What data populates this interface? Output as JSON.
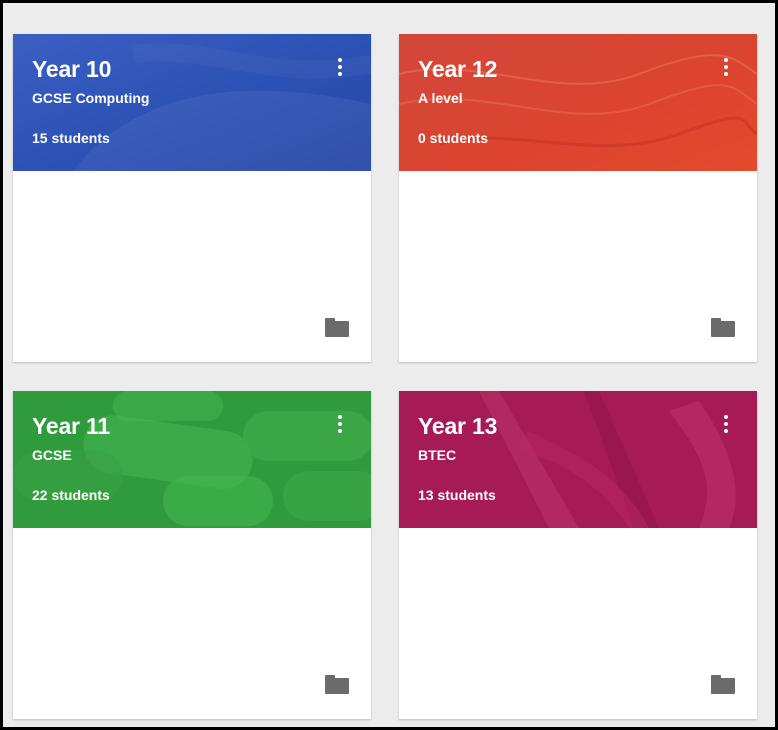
{
  "classes": [
    {
      "title": "Year 10",
      "subtitle": "GCSE Computing",
      "students": "15 students",
      "theme": "#2f56b8"
    },
    {
      "title": "Year 12",
      "subtitle": "A level",
      "students": "0 students",
      "theme": "#d9412e"
    },
    {
      "title": "Year 11",
      "subtitle": "GCSE",
      "students": "22 students",
      "theme": "#2f9b3d"
    },
    {
      "title": "Year 13",
      "subtitle": "BTEC",
      "students": "13 students",
      "theme": "#a61a56"
    }
  ],
  "icons": {
    "menu": "more-vert-icon",
    "folder": "folder-icon"
  }
}
